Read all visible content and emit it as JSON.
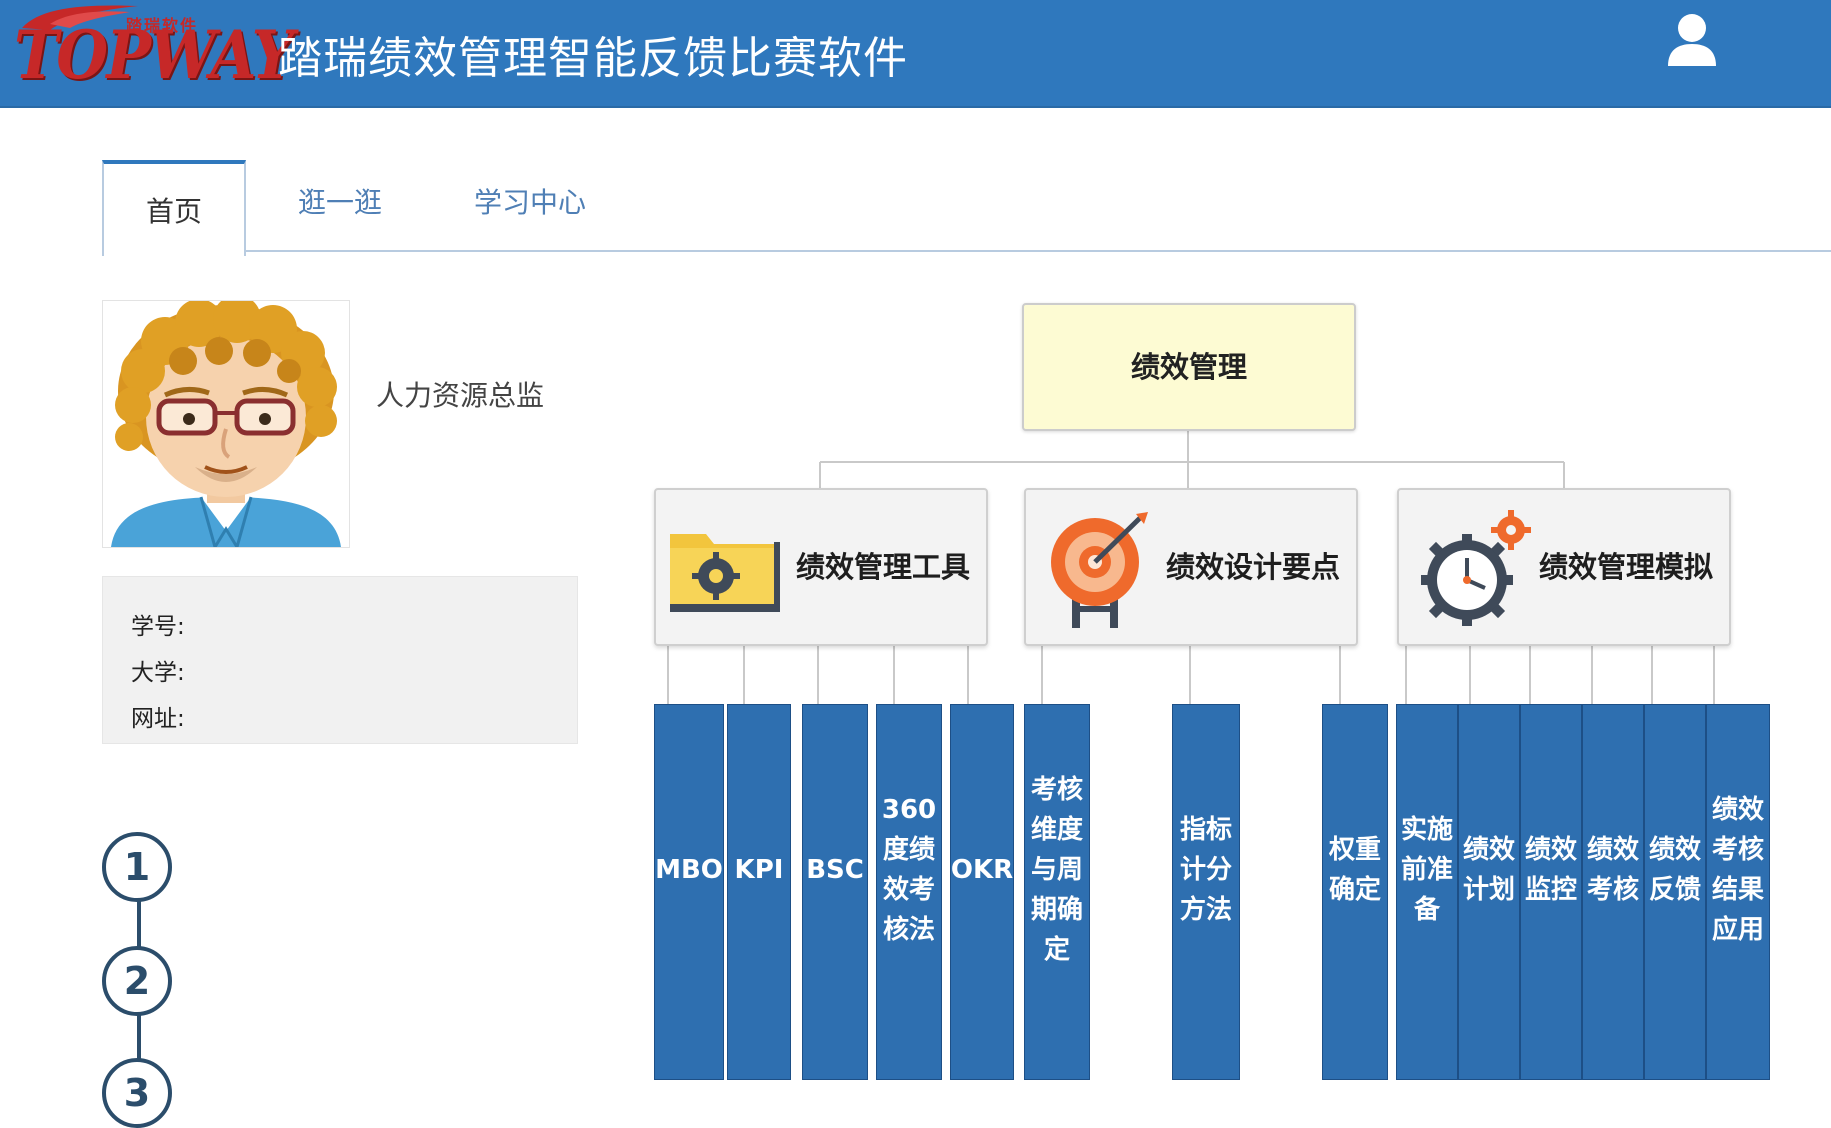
{
  "header": {
    "logo_text": "TOPWAY",
    "logo_cn": "踏瑞软件",
    "app_title": "踏瑞绩效管理智能反馈比赛软件"
  },
  "tabs": [
    {
      "label": "首页",
      "active": true
    },
    {
      "label": "逛一逛",
      "active": false
    },
    {
      "label": "学习中心",
      "active": false
    }
  ],
  "profile": {
    "role": "人力资源总监",
    "fields": [
      {
        "label": "学号:",
        "value": ""
      },
      {
        "label": "大学:",
        "value": ""
      },
      {
        "label": "网址:",
        "value": ""
      }
    ]
  },
  "steps": [
    "1",
    "2",
    "3"
  ],
  "org_chart": {
    "root": "绩效管理",
    "categories": [
      {
        "label": "绩效管理工具",
        "icon": "folder-gear-icon"
      },
      {
        "label": "绩效设计要点",
        "icon": "target-icon"
      },
      {
        "label": "绩效管理模拟",
        "icon": "clock-gear-icon"
      }
    ],
    "leaves": [
      {
        "text": "MBO",
        "category": 0
      },
      {
        "text": "KPI",
        "category": 0
      },
      {
        "text": "BSC",
        "category": 0
      },
      {
        "text": "360度绩效考核法",
        "category": 0
      },
      {
        "text": "OKR",
        "category": 0
      },
      {
        "text": "考核维度与周期确定",
        "category": 1
      },
      {
        "text": "指标计分方法",
        "category": 1
      },
      {
        "text": "权重确定",
        "category": 1
      },
      {
        "text": "实施前准备",
        "category": 2
      },
      {
        "text": "绩效计划",
        "category": 2
      },
      {
        "text": "绩效监控",
        "category": 2
      },
      {
        "text": "绩效考核",
        "category": 2
      },
      {
        "text": "绩效反馈",
        "category": 2
      },
      {
        "text": "绩效考核结果应用",
        "category": 2
      }
    ]
  },
  "colors": {
    "header_bg": "#2f78bd",
    "leaf_bg": "#2e6fb0",
    "root_bg": "#fdfbd3",
    "step_border": "#2b4d6b"
  }
}
